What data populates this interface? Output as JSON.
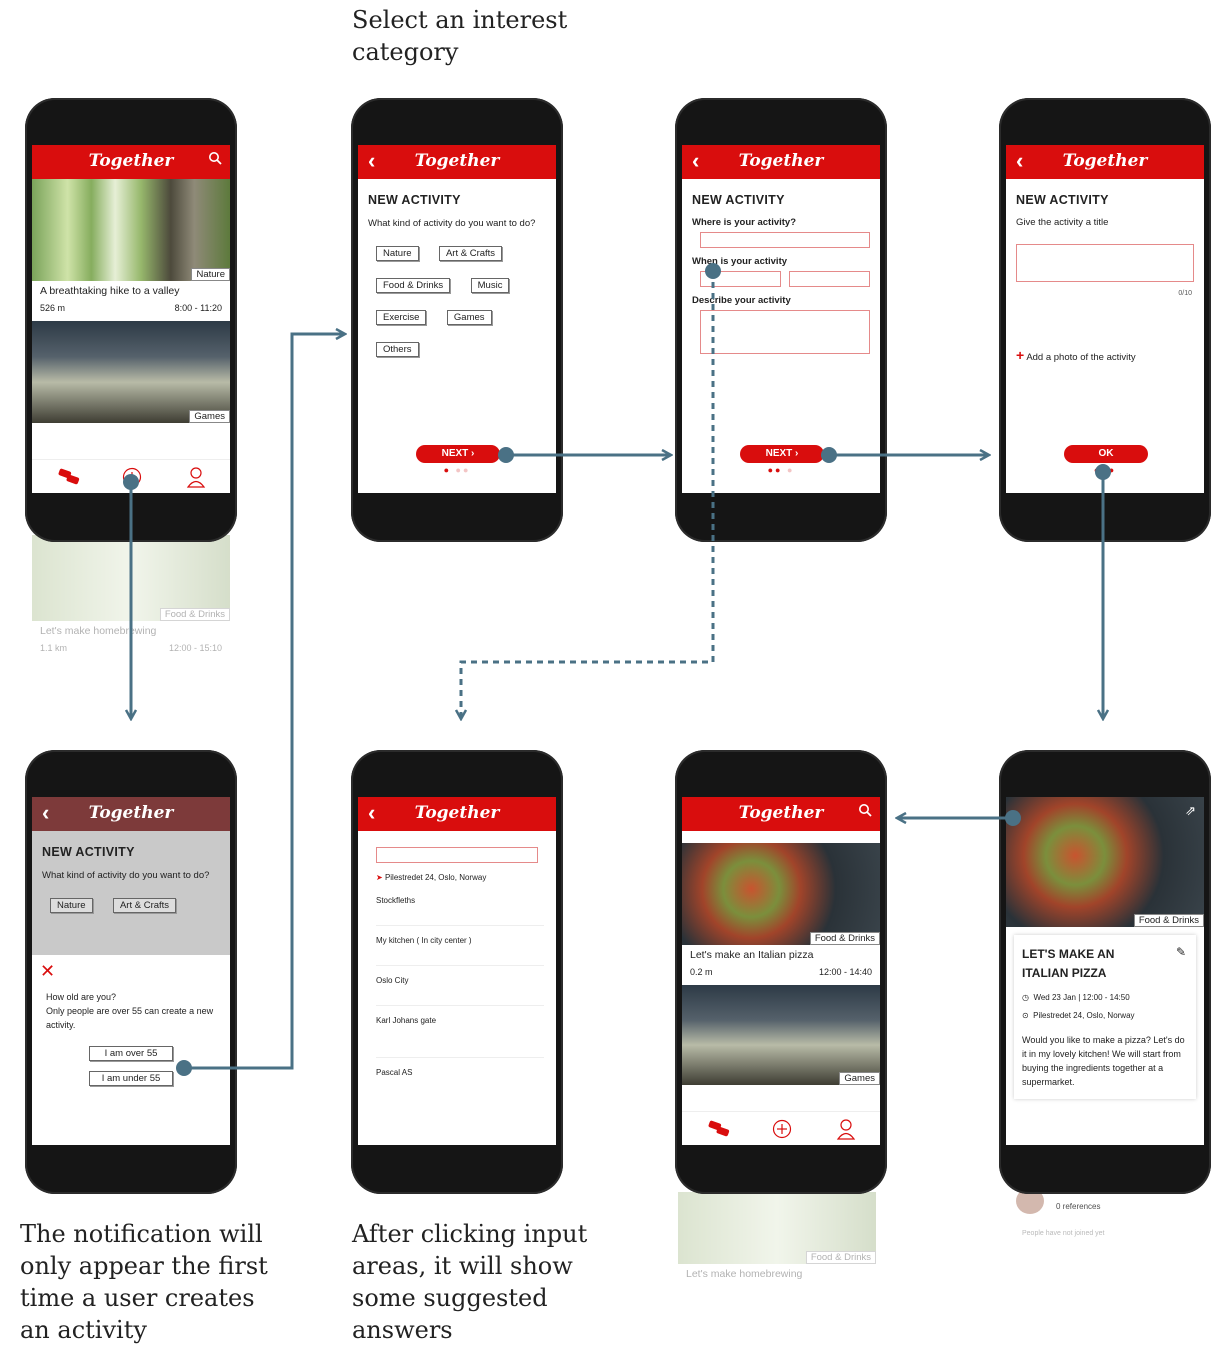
{
  "captions": {
    "select_interest": "Select an interest category",
    "notification": "The notification will only appear the first time a user creates an activity",
    "suggested": "After clicking input areas, it will show some suggested answers"
  },
  "app": {
    "title": "Together",
    "brand_color": "#d90d0d",
    "arrow_color": "#4a7185"
  },
  "feed": {
    "card1": {
      "tag": "Nature",
      "title": "A breathtaking hike to a valley",
      "distance": "526 m",
      "time": "8:00 - 11:20"
    },
    "card2": {
      "tag": "Games"
    },
    "ghost": {
      "tag": "Food & Drinks",
      "title": "Let's make homebrewing",
      "distance": "1.1 km",
      "time": "12:00 - 15:10"
    }
  },
  "new_activity": {
    "heading": "NEW ACTIVITY",
    "question": "What kind of activity do you want to do?",
    "categories": [
      "Nature",
      "Art & Crafts",
      "Food & Drinks",
      "Music",
      "Exercise",
      "Games",
      "Others"
    ],
    "next_label": "NEXT",
    "ok_label": "OK"
  },
  "step2": {
    "where_label": "Where is your activity?",
    "when_label": "When is your activity",
    "describe_label": "Describe your activity"
  },
  "step3": {
    "title_label": "Give the activity a title",
    "counter": "0/10",
    "add_photo": "Add a photo of the activity"
  },
  "age_dialog": {
    "line1": "How old are you?",
    "line2": "Only people are over 55 can create a new activity.",
    "over": "I am over 55",
    "under": "I am under 55"
  },
  "suggestions": {
    "location": "Pilestredet 24, Oslo, Norway",
    "items": [
      "Stockfleths",
      "My kitchen ( In city center )",
      "Oslo City",
      "Karl Johans gate",
      "Pascal AS"
    ]
  },
  "feed2": {
    "tag": "Food & Drinks",
    "title": "Let's make an Italian pizza",
    "distance": "0.2 m",
    "time": "12:00 - 14:40",
    "tag2": "Games",
    "ghost_tag": "Food & Drinks",
    "ghost_title": "Let's make homebrewing"
  },
  "detail": {
    "tag": "Food & Drinks",
    "title": "LET'S MAKE AN ITALIAN PIZZA",
    "datetime": "Wed 23 Jan | 12:00 - 14:50",
    "location": "Pilestredet 24, Oslo, Norway",
    "description": "Would you like to make a pizza? Let's do it in my lovely kitchen! We will start from buying the ingredients together at a supermarket.",
    "references": "0 references",
    "joined": "People have not joined yet"
  }
}
